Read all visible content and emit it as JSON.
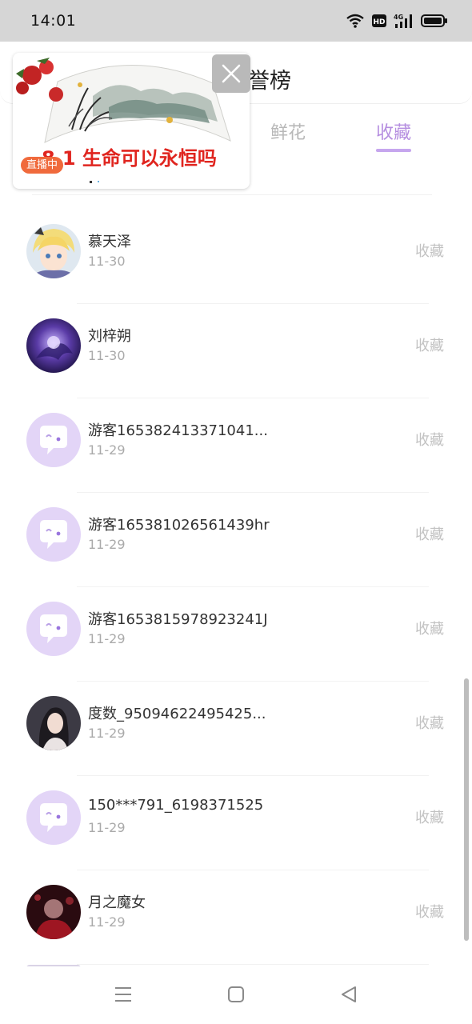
{
  "status_bar": {
    "time": "14:01",
    "icons": [
      "wifi-icon",
      "hd-icon",
      "4g-signal-icon",
      "battery-icon"
    ]
  },
  "header": {
    "title": "誉榜"
  },
  "tabs": [
    {
      "label": "鲜花",
      "active": false
    },
    {
      "label": "收藏",
      "active": true
    }
  ],
  "live_video": {
    "caption": "8.1 生命可以永恒吗",
    "badge": "直播中"
  },
  "rows": [
    {
      "name": "慕天泽",
      "date": "11-30",
      "action": "收藏",
      "avatar": "anime-avatar"
    },
    {
      "name": "刘梓朔",
      "date": "11-30",
      "action": "收藏",
      "avatar": "purple-avatar"
    },
    {
      "name": "游客165382413371041...",
      "date": "11-29",
      "action": "收藏",
      "avatar": "default-avatar"
    },
    {
      "name": "游客165381026561439hr",
      "date": "11-29",
      "action": "收藏",
      "avatar": "default-avatar"
    },
    {
      "name": "游客1653815978923241J",
      "date": "11-29",
      "action": "收藏",
      "avatar": "default-avatar"
    },
    {
      "name": "度数_95094622495425...",
      "date": "11-29",
      "action": "收藏",
      "avatar": "photo-avatar"
    },
    {
      "name": "150***791_6198371525",
      "date": "11-29",
      "action": "收藏",
      "avatar": "default-avatar"
    },
    {
      "name": "月之魔女",
      "date": "11-29",
      "action": "收藏",
      "avatar": "red-avatar"
    }
  ],
  "colors": {
    "accent": "#b58ee0",
    "muted": "#c2c2c2",
    "default_avatar": "#e3d5f7"
  }
}
